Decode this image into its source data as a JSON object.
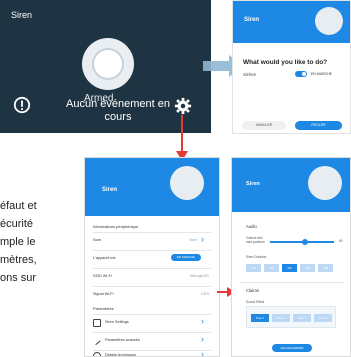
{
  "panel_a": {
    "title": "Siren",
    "status_line1": "Aucun événement en",
    "status_line2": "cours",
    "overlap_text": "Armed"
  },
  "phone_b": {
    "header_title": "Siren",
    "question": "What would you like to do?",
    "siren_label": "Sirène",
    "toggle_label": "EN MARCHE",
    "cancel_label": "ANNULER",
    "ok_label": "REGLER"
  },
  "phone_c": {
    "header_title": "Siren",
    "section_info": "Informations périphérique",
    "rows": [
      {
        "label": "Nom",
        "value": "Siren"
      },
      {
        "label": "L'appareil est",
        "value": "EN MARCHE"
      },
      {
        "label": "SSID Wi-Fi",
        "value": "WalongeGSX"
      },
      {
        "label": "Signal Wi-Fi",
        "value": "100%"
      }
    ],
    "section_params": "Paramètres",
    "settings": [
      {
        "label": "Siren Settings"
      },
      {
        "label": "Paramètres avancés"
      },
      {
        "label": "Détails techniques"
      }
    ]
  },
  "phone_d": {
    "header_title": "Siren",
    "section_audio": "Audio",
    "volume_label": "Volume des haut-parleurs",
    "volume_value": "60",
    "duration_label": "Siren Duration",
    "durations": [
      "1M",
      "3M",
      "5M",
      "10M",
      "15M"
    ],
    "duration_selected": 2,
    "section_light": "Clairon",
    "sound_label": "Sound Effect",
    "sounds": [
      "Tone 1",
      "Tone 2",
      "Tone 3",
      "Tone 4"
    ],
    "sound_selected": 0,
    "save_label": "SAUVEGARDER"
  },
  "side_text": {
    "line1": "éfaut et",
    "line2": "écurité",
    "line3": "mple le",
    "line4": "mètres,",
    "line5": "ons sur"
  },
  "colors": {
    "dark_panel": "#1f3442",
    "accent": "#1e88e5",
    "arrow": "#e53935"
  }
}
